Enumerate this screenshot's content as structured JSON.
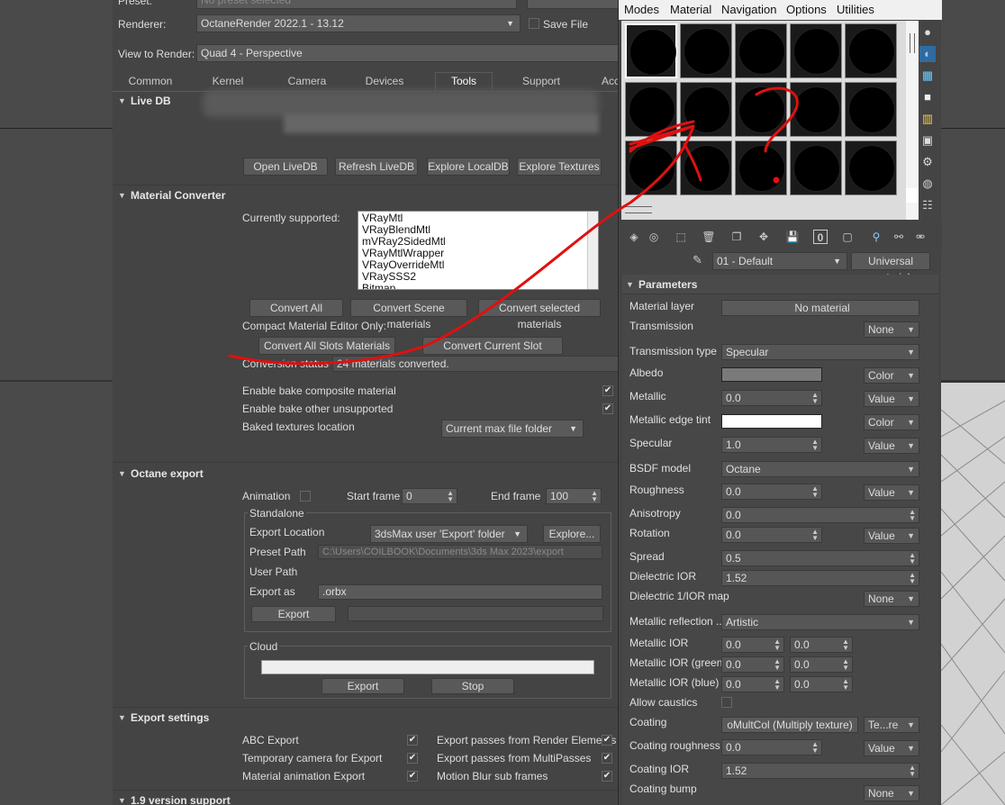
{
  "top": {
    "preset_label": "Preset:",
    "preset_value": "No preset selected",
    "renderer_label": "Renderer:",
    "renderer_value": "OctaneRender 2022.1 - 13.12",
    "save_file": "Save File",
    "view_label": "View to Render:",
    "view_value": "Quad 4 - Perspective"
  },
  "tabs": [
    "Common",
    "Kernel",
    "Camera",
    "Devices",
    "Tools",
    "Support",
    "Acc"
  ],
  "livedb": {
    "title": "Live DB",
    "buttons": [
      "Open LiveDB",
      "Refresh LiveDB",
      "Explore LocalDB",
      "Explore Textures"
    ]
  },
  "converter": {
    "title": "Material Converter",
    "supported_label": "Currently supported:",
    "supported_list": [
      "VRayMtl",
      "VRayBlendMtl",
      "mVRay2SidedMtl",
      "VRayMtlWrapper",
      "VRayOverrideMtl",
      "VRaySSS2",
      "Bitmap"
    ],
    "convert_all": "Convert All",
    "convert_scene": "Convert Scene materials",
    "convert_selected": "Convert selected materials",
    "compact_label": "Compact Material Editor Only:",
    "convert_all_slots": "Convert All Slots Materials",
    "convert_current_slot": "Convert Current Slot Material",
    "status_label": "Conversion status",
    "status_value": "24 materials converted.",
    "bake_composite": "Enable bake composite material",
    "bake_other": "Enable bake other unsupported",
    "baked_loc_label": "Baked textures location",
    "baked_loc_value": "Current max file folder"
  },
  "export": {
    "title": "Octane export",
    "animation": "Animation",
    "start_frame_label": "Start frame",
    "start_frame": "0",
    "end_frame_label": "End frame",
    "end_frame": "100",
    "standalone": "Standalone",
    "export_location_label": "Export Location",
    "export_location_value": "3dsMax user 'Export' folder",
    "explore": "Explore...",
    "preset_path_label": "Preset Path",
    "preset_path_value": "C:\\Users\\COILBOOK\\Documents\\3ds Max 2023\\export",
    "user_path_label": "User Path",
    "export_as_label": "Export as",
    "export_as_value": ".orbx",
    "export_btn": "Export",
    "cloud": "Cloud",
    "cloud_export": "Export",
    "cloud_stop": "Stop"
  },
  "export_settings": {
    "title": "Export settings",
    "abc": "ABC Export",
    "temp_cam": "Temporary camera for Export",
    "mat_anim": "Material animation Export",
    "passes_render": "Export passes from Render Elements",
    "passes_multi": "Export passes from MultiPasses",
    "motion_blur": "Motion Blur sub frames"
  },
  "v19": {
    "title": "1.9 version support"
  },
  "editor": {
    "menus": [
      "Modes",
      "Material",
      "Navigation",
      "Options",
      "Utilities"
    ],
    "material_name": "01 - Default",
    "material_type": "Universal material",
    "params_title": "Parameters",
    "params": {
      "material_layer": "Material layer",
      "no_material": "No material",
      "transmission": "Transmission",
      "none": "None",
      "transmission_type": "Transmission type",
      "specular": "Specular",
      "albedo": "Albedo",
      "color": "Color",
      "metallic": "Metallic",
      "value": "Value",
      "metallic_edge_tint": "Metallic edge tint",
      "specular_label": "Specular",
      "bsdf_model": "BSDF model",
      "octane": "Octane",
      "roughness": "Roughness",
      "anisotropy": "Anisotropy",
      "rotation": "Rotation",
      "spread": "Spread",
      "dielectric_ior": "Dielectric IOR",
      "dielectric_map": "Dielectric 1/IOR map",
      "metallic_reflection": "Metallic reflection ...",
      "artistic": "Artistic",
      "metallic_ior": "Metallic IOR",
      "metallic_ior_green": "Metallic IOR (green)",
      "metallic_ior_blue": "Metallic IOR (blue)",
      "allow_caustics": "Allow caustics",
      "coating": "Coating",
      "coating_map": "oMultCol (Multiply texture)",
      "coating_type": "Te...re",
      "coating_roughness": "Coating roughness",
      "coating_ior": "Coating IOR",
      "coating_bump": "Coating bump",
      "v_zero": "0.0",
      "v_one": "1.0",
      "v_half": "0.5",
      "v_152": "1.52"
    }
  },
  "colors": {
    "albedo": "#7a7a7a",
    "edge_tint": "#ffffff",
    "annotation": "#e01010"
  }
}
